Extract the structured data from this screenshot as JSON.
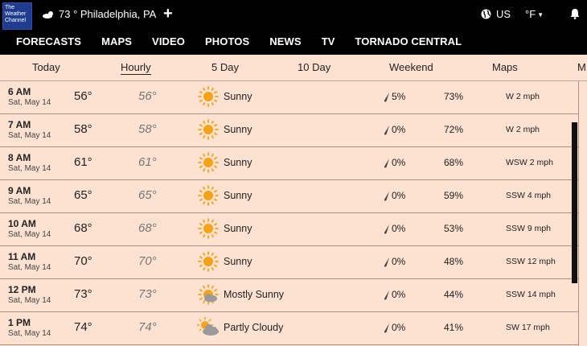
{
  "brand": {
    "logo_lines": [
      "The",
      "Weather",
      "Channel"
    ]
  },
  "header": {
    "location": "73 ° Philadelphia, PA",
    "region": "US",
    "unit": "°F"
  },
  "main_nav": [
    "FORECASTS",
    "MAPS",
    "VIDEO",
    "PHOTOS",
    "NEWS",
    "TV",
    "TORNADO CENTRAL"
  ],
  "sub_tabs": [
    {
      "label": "Today"
    },
    {
      "label": "Hourly",
      "active": true
    },
    {
      "label": "5 Day"
    },
    {
      "label": "10 Day"
    },
    {
      "label": "Weekend"
    },
    {
      "label": "Maps"
    },
    {
      "label": "M"
    }
  ],
  "hourly": [
    {
      "time": "6 AM",
      "date": "Sat, May 14",
      "temp": "56°",
      "feels": "56°",
      "icon": "sunny-icon",
      "condition": "Sunny",
      "precip": "5%",
      "humidity": "73%",
      "wind": "W 2 mph"
    },
    {
      "time": "7 AM",
      "date": "Sat, May 14",
      "temp": "58°",
      "feels": "58°",
      "icon": "sunny-icon",
      "condition": "Sunny",
      "precip": "0%",
      "humidity": "72%",
      "wind": "W 2 mph"
    },
    {
      "time": "8 AM",
      "date": "Sat, May 14",
      "temp": "61°",
      "feels": "61°",
      "icon": "sunny-icon",
      "condition": "Sunny",
      "precip": "0%",
      "humidity": "68%",
      "wind": "WSW 2 mph"
    },
    {
      "time": "9 AM",
      "date": "Sat, May 14",
      "temp": "65°",
      "feels": "65°",
      "icon": "sunny-icon",
      "condition": "Sunny",
      "precip": "0%",
      "humidity": "59%",
      "wind": "SSW 4 mph"
    },
    {
      "time": "10 AM",
      "date": "Sat, May 14",
      "temp": "68°",
      "feels": "68°",
      "icon": "sunny-icon",
      "condition": "Sunny",
      "precip": "0%",
      "humidity": "53%",
      "wind": "SSW 9 mph"
    },
    {
      "time": "11 AM",
      "date": "Sat, May 14",
      "temp": "70°",
      "feels": "70°",
      "icon": "sunny-icon",
      "condition": "Sunny",
      "precip": "0%",
      "humidity": "48%",
      "wind": "SSW 12 mph"
    },
    {
      "time": "12 PM",
      "date": "Sat, May 14",
      "temp": "73°",
      "feels": "73°",
      "icon": "mostly-sunny-icon",
      "condition": "Mostly Sunny",
      "precip": "0%",
      "humidity": "44%",
      "wind": "SSW 14 mph"
    },
    {
      "time": "1 PM",
      "date": "Sat, May 14",
      "temp": "74°",
      "feels": "74°",
      "icon": "partly-cloudy-icon",
      "condition": "Partly Cloudy",
      "precip": "0%",
      "humidity": "41%",
      "wind": "SW 17 mph"
    }
  ],
  "colors": {
    "background": "#fde1d1",
    "header": "#000000",
    "sun": "#f5a316",
    "logo": "#1f3c8f"
  }
}
